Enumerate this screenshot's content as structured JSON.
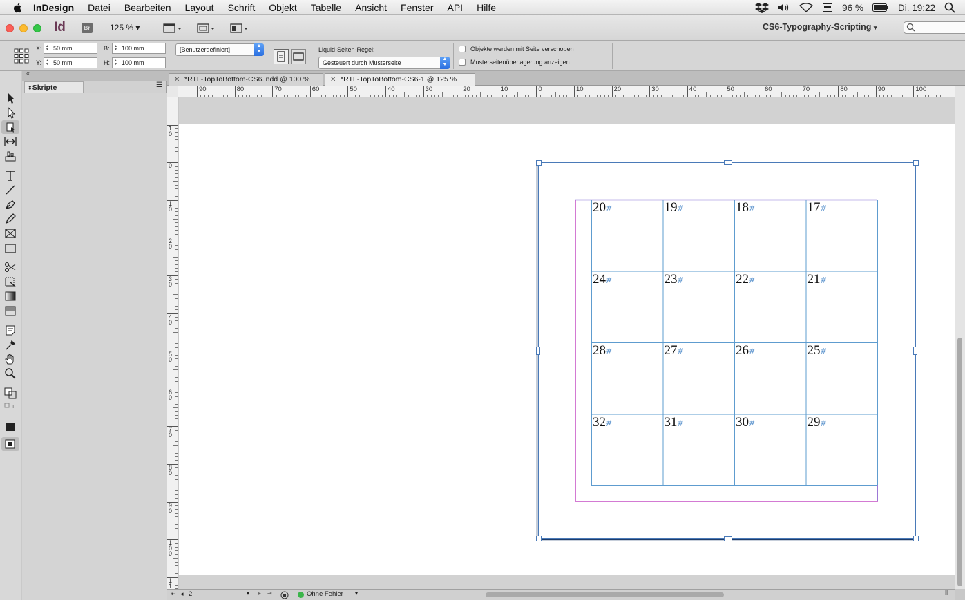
{
  "menubar": {
    "items": [
      "InDesign",
      "Datei",
      "Bearbeiten",
      "Layout",
      "Schrift",
      "Objekt",
      "Tabelle",
      "Ansicht",
      "Fenster",
      "API",
      "Hilfe"
    ],
    "battery": "96 %",
    "clock": "Di. 19:22"
  },
  "appbar": {
    "app_logo": "Id",
    "bridge_logo": "Br",
    "zoom": "125 %",
    "workspace": "CS6-Typography-Scripting"
  },
  "control": {
    "x_label": "X:",
    "x_value": "50 mm",
    "y_label": "Y:",
    "y_value": "50 mm",
    "w_label": "B:",
    "w_value": "100 mm",
    "h_label": "H:",
    "h_value": "100 mm",
    "preset": "[Benutzerdefiniert]",
    "liquid_label": "Liquid-Seiten-Regel:",
    "liquid_value": "Gesteuert durch Musterseite",
    "check1": "Objekte werden mit Seite verschoben",
    "check2": "Musterseitenüberlagerung anzeigen"
  },
  "panel": {
    "tab": "Skripte"
  },
  "doc_tabs": [
    {
      "label": "*RTL-TopToBottom-CS6.indd @ 100 %",
      "active": false
    },
    {
      "label": "*RTL-TopToBottom-CS6-1 @ 125 %",
      "active": true
    }
  ],
  "hruler_labels": [
    "90",
    "80",
    "70",
    "60",
    "50",
    "40",
    "30",
    "20",
    "10",
    "0",
    "10",
    "20",
    "30",
    "40",
    "50",
    "60",
    "70",
    "80",
    "90",
    "100"
  ],
  "vruler_labels": [
    "1\n0",
    "0",
    "1\n0",
    "2\n0",
    "3\n0",
    "4\n0",
    "5\n0",
    "6\n0",
    "7\n0",
    "8\n0",
    "9\n0",
    "1\n0\n0",
    "1\n1"
  ],
  "table": {
    "rows": [
      [
        "20",
        "19",
        "18",
        "17"
      ],
      [
        "24",
        "23",
        "22",
        "21"
      ],
      [
        "28",
        "27",
        "26",
        "25"
      ],
      [
        "32",
        "31",
        "30",
        "29"
      ]
    ],
    "cell_marker": "#"
  },
  "status": {
    "page": "2",
    "preflight": "Ohne Fehler"
  },
  "colors": {
    "frame_blue": "#4a7ab8",
    "margin_magenta": "#d37ad3",
    "margin_violet": "#8a78d8",
    "table_line": "#5e9ccf",
    "preflight_ok": "#3bb54a"
  }
}
